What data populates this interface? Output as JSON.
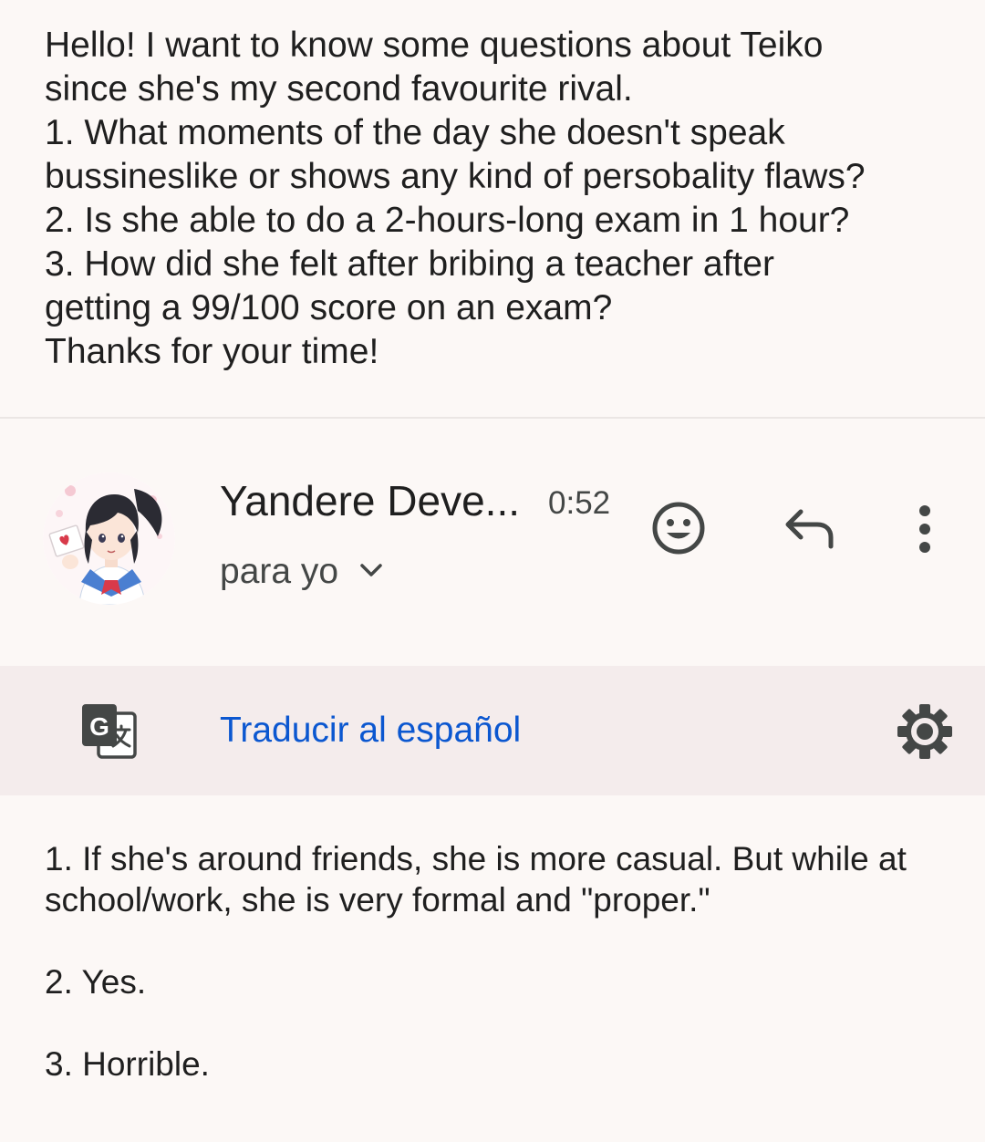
{
  "quoted_message": {
    "lines": [
      "Hello! I want to know some questions about Teiko",
      "since she's my second favourite rival.",
      "1. What moments of the day she doesn't speak",
      "bussineslike or shows any kind of persobality flaws?",
      "2. Is she able to do a 2-hours-long exam in 1 hour?",
      "3. How did she felt after bribing a teacher after",
      "getting a 99/100 score on an exam?",
      "Thanks for your time!"
    ]
  },
  "message_header": {
    "sender_name": "Yandere Deve...",
    "time": "0:52",
    "recipient_label": "para yo",
    "icons": {
      "avatar": "anime-girl-avatar",
      "expand": "chevron-down-icon",
      "emoji": "smiley-icon",
      "reply": "reply-arrow-icon",
      "more": "more-vert-icon"
    },
    "icon_color": "#444746"
  },
  "translate_bar": {
    "link_label": "Traducir al español",
    "link_color": "#0b57d0",
    "background": "#f4ecec",
    "icons": {
      "translate": "google-translate-icon",
      "settings": "gear-icon"
    }
  },
  "reply_body": {
    "paragraph_1_line_1": "1. If she's around friends, she is more casual. But while at",
    "paragraph_1_line_2": "school/work, she is very formal and \"proper.\"",
    "paragraph_2": "2. Yes.",
    "paragraph_3": "3. Horrible."
  }
}
